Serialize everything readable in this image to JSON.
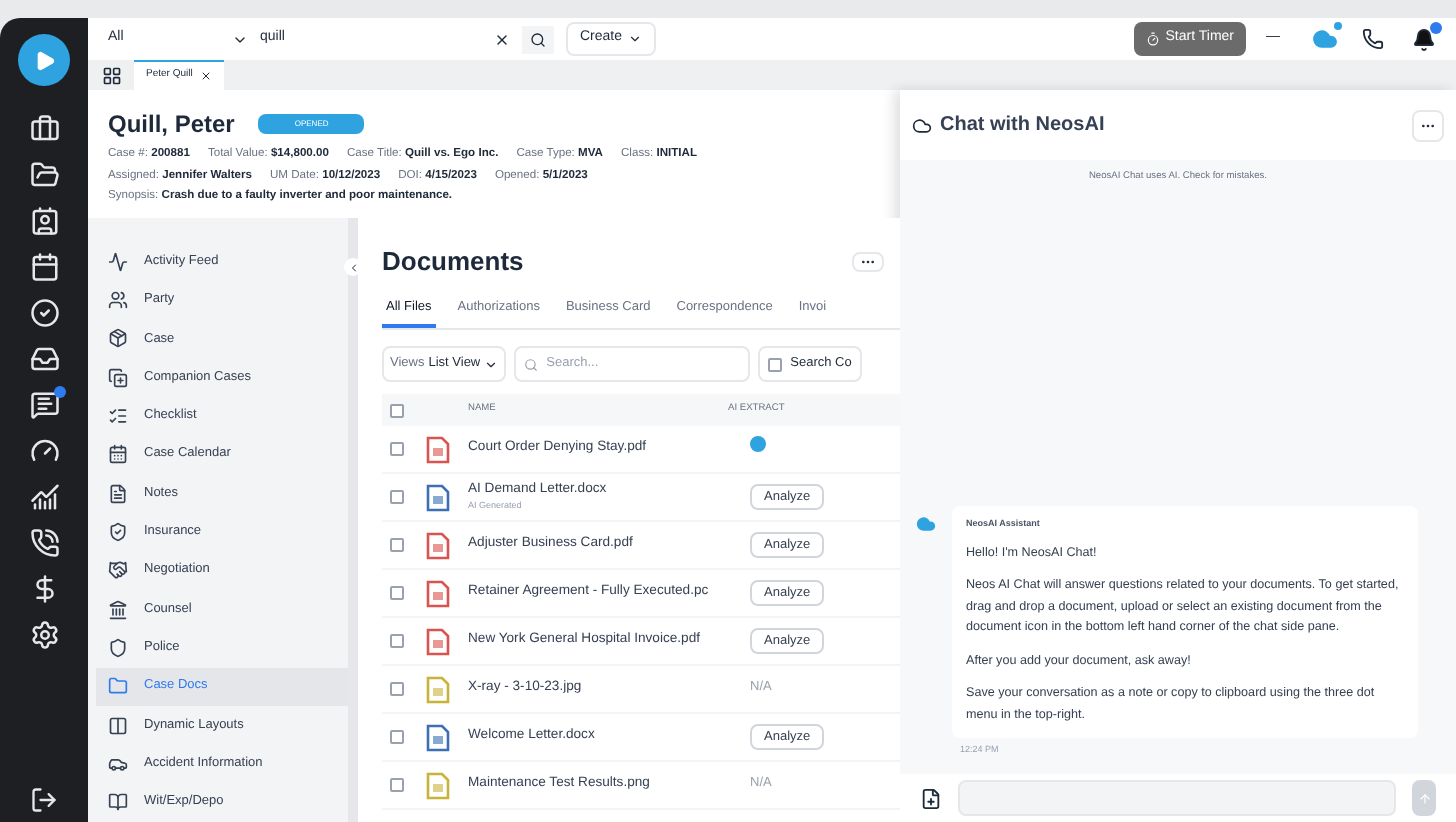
{
  "top_bar": {
    "scope": "All",
    "search_value": "quill",
    "create_label": "Create",
    "timer_label": "Start Timer",
    "minimize_label": "—"
  },
  "tabs": [
    {
      "label": "Peter Quill",
      "selected": true
    }
  ],
  "case": {
    "name": "Quill, Peter",
    "status": "OPENED",
    "fields": [
      {
        "label": "Case #:",
        "value": "200881"
      },
      {
        "label": "Total Value:",
        "value": "$14,800.00"
      },
      {
        "label": "Case Title:",
        "value": "Quill vs. Ego Inc."
      },
      {
        "label": "Case Type:",
        "value": "MVA"
      },
      {
        "label": "Class:",
        "value": "INITIAL"
      }
    ],
    "fields2": [
      {
        "label": "Assigned:",
        "value": "Jennifer Walters"
      },
      {
        "label": "UM Date:",
        "value": "10/12/2023"
      },
      {
        "label": "DOI:",
        "value": "4/15/2023"
      },
      {
        "label": "Opened:",
        "value": "5/1/2023"
      }
    ],
    "synopsis": {
      "label": "Synopsis:",
      "value": "Crash due to a faulty inverter and poor maintenance."
    }
  },
  "sidebar": {
    "items": [
      {
        "label": "Activity Feed",
        "selected": false
      },
      {
        "label": "Party",
        "selected": false
      },
      {
        "label": "Case",
        "selected": false
      },
      {
        "label": "Companion Cases",
        "selected": false
      },
      {
        "label": "Checklist",
        "selected": false
      },
      {
        "label": "Case Calendar",
        "selected": false
      },
      {
        "label": "Notes",
        "selected": false
      },
      {
        "label": "Insurance",
        "selected": false
      },
      {
        "label": "Negotiation",
        "selected": false
      },
      {
        "label": "Counsel",
        "selected": false
      },
      {
        "label": "Police",
        "selected": false
      },
      {
        "label": "Case Docs",
        "selected": true
      },
      {
        "label": "Dynamic Layouts",
        "selected": false
      },
      {
        "label": "Accident Information",
        "selected": false
      },
      {
        "label": "Wit/Exp/Depo",
        "selected": false
      }
    ]
  },
  "documents": {
    "title": "Documents",
    "tabs": [
      {
        "label": "All Files",
        "selected": true
      },
      {
        "label": "Authorizations",
        "selected": false
      },
      {
        "label": "Business Card",
        "selected": false
      },
      {
        "label": "Correspondence",
        "selected": false
      },
      {
        "label": "Invoi",
        "selected": false
      }
    ],
    "views_label": "Views",
    "view_value": "List View",
    "search_placeholder": "Search...",
    "search_content_label": "Search Co",
    "search_content_checked": false,
    "select_all_checked": false,
    "columns": [
      "NAME",
      "AI EXTRACT"
    ],
    "rows": [
      {
        "name": "Court Order Denying Stay.pdf",
        "kind": "pdf",
        "checked": false,
        "extract": {
          "kind": "done"
        }
      },
      {
        "name": "AI Demand Letter.docx",
        "note": "AI Generated",
        "kind": "doc",
        "checked": false,
        "extract": {
          "kind": "button",
          "label": "Analyze"
        }
      },
      {
        "name": "Adjuster Business Card.pdf",
        "kind": "pdf",
        "checked": false,
        "extract": {
          "kind": "button",
          "label": "Analyze"
        }
      },
      {
        "name": "Retainer Agreement - Fully Executed.pc",
        "kind": "pdf",
        "checked": false,
        "extract": {
          "kind": "button",
          "label": "Analyze"
        }
      },
      {
        "name": "New York General Hospital Invoice.pdf",
        "kind": "pdf",
        "checked": false,
        "extract": {
          "kind": "button",
          "label": "Analyze"
        }
      },
      {
        "name": "X-ray - 3-10-23.jpg",
        "kind": "image",
        "checked": false,
        "extract": {
          "kind": "text",
          "label": "N/A"
        }
      },
      {
        "name": "Welcome Letter.docx",
        "kind": "doc",
        "checked": false,
        "extract": {
          "kind": "button",
          "label": "Analyze"
        }
      },
      {
        "name": "Maintenance Test Results.png",
        "kind": "image",
        "checked": false,
        "extract": {
          "kind": "text",
          "label": "N/A"
        }
      }
    ]
  },
  "chat": {
    "title": "Chat with NeosAI",
    "disclaimer": "NeosAI Chat uses AI. Check for mistakes.",
    "message": {
      "sender": "NeosAI Assistant",
      "paragraphs": [
        "Hello! I'm NeosAI Chat!",
        "Neos AI Chat will answer questions related to your documents. To get started, drag and drop a document, upload or select an existing document from the document icon in the bottom left hand corner of the chat side pane.",
        "After you add your document, ask away!",
        "Save your conversation as a note or copy to clipboard using the three dot menu in the top-right."
      ],
      "time": "12:24 PM"
    }
  }
}
